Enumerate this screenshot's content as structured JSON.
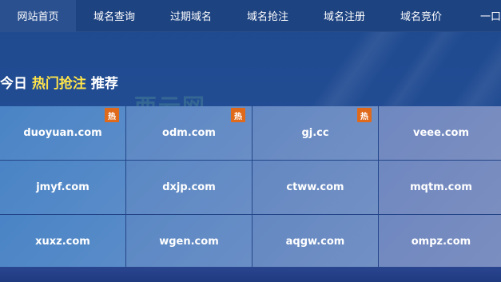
{
  "nav": {
    "items": [
      {
        "label": "网站首页",
        "active": true
      },
      {
        "label": "域名查询"
      },
      {
        "label": "过期域名"
      },
      {
        "label": "域名抢注"
      },
      {
        "label": "域名注册"
      },
      {
        "label": "域名竞价"
      },
      {
        "label": "一口"
      }
    ]
  },
  "heading": {
    "pre": "今日",
    "highlight": "热门抢注",
    "post": "推荐"
  },
  "watermark": "西云网",
  "hot_badge": "热",
  "domains": [
    {
      "name": "duoyuan.com",
      "hot": true
    },
    {
      "name": "odm.com",
      "hot": true
    },
    {
      "name": "gj.cc",
      "hot": true
    },
    {
      "name": "veee.com",
      "hot": false
    },
    {
      "name": "jmyf.com",
      "hot": false
    },
    {
      "name": "dxjp.com",
      "hot": false
    },
    {
      "name": "ctww.com",
      "hot": false
    },
    {
      "name": "mqtm.com",
      "hot": false
    },
    {
      "name": "xuxz.com",
      "hot": false
    },
    {
      "name": "wgen.com",
      "hot": false
    },
    {
      "name": "aqgw.com",
      "hot": false
    },
    {
      "name": "ompz.com",
      "hot": false
    }
  ],
  "colors": {
    "nav_bg": "#1d4381",
    "nav_active": "#2a5090",
    "highlight": "#ffe44a",
    "hot_badge": "#e06a1c"
  }
}
